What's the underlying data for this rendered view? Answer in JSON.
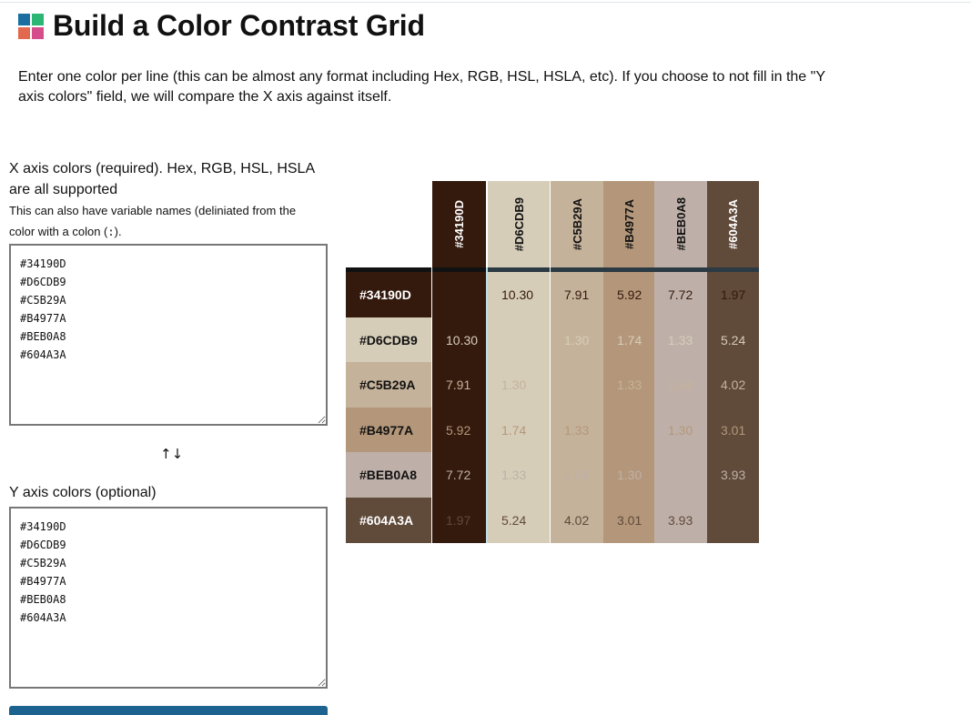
{
  "header": {
    "title": "Build a Color Contrast Grid",
    "logo_colors": [
      "#1a6fa0",
      "#2bb673",
      "#e2684f",
      "#d64d8c"
    ]
  },
  "intro": "Enter one color per line (this can be almost any format including Hex, RGB, HSL, HSLA, etc). If you choose to not fill in the \"Y axis colors\" field, we will compare the X axis against itself.",
  "x_axis": {
    "label": "X axis colors (required). Hex, RGB, HSL, HSLA are all supported",
    "sublabel_prefix": "This can also have variable names (deliniated from the color with a colon (",
    "sublabel_code": ":",
    "sublabel_suffix": ").",
    "value": "#34190D\n#D6CDB9\n#C5B29A\n#B4977A\n#BEB0A8\n#604A3A"
  },
  "swap_icon": "↑↓",
  "y_axis": {
    "label": "Y axis colors (optional)",
    "value": "#34190D\n#D6CDB9\n#C5B29A\n#B4977A\n#BEB0A8\n#604A3A"
  },
  "grid": {
    "colors": [
      "#34190D",
      "#D6CDB9",
      "#C5B29A",
      "#B4977A",
      "#BEB0A8",
      "#604A3A"
    ],
    "text_colors": [
      "#ffffff",
      "#111111",
      "#111111",
      "#111111",
      "#111111",
      "#ffffff"
    ],
    "ratios": [
      [
        "",
        "10.30",
        "7.91",
        "5.92",
        "7.72",
        "1.97"
      ],
      [
        "10.30",
        "",
        "1.30",
        "1.74",
        "1.33",
        "5.24"
      ],
      [
        "7.91",
        "1.30",
        "",
        "1.33",
        "1.04",
        "4.02"
      ],
      [
        "5.92",
        "1.74",
        "1.33",
        "",
        "1.30",
        "3.01"
      ],
      [
        "7.72",
        "1.33",
        "1.04",
        "1.30",
        "",
        "3.93"
      ],
      [
        "1.97",
        "5.24",
        "4.02",
        "3.01",
        "3.93",
        ""
      ]
    ]
  }
}
